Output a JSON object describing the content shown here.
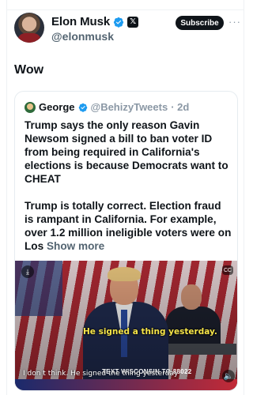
{
  "author": {
    "name": "Elon Musk",
    "handle": "@elonmusk",
    "x_badge": "𝕏"
  },
  "header": {
    "subscribe_label": "Subscribe",
    "more_label": "···"
  },
  "post": {
    "text": "Wow"
  },
  "quote": {
    "author_name": "George",
    "author_handle": "@BehizyTweets",
    "time": "· 2d",
    "paragraph1": "Trump says the only reason Gavin Newsom signed a bill to ban voter ID from being required in California's elections is because Democrats want to CHEAT",
    "paragraph2": "Trump is totally correct. Election fraud is rampant in California. For example, over 1.2 million ineligible voters were on Los",
    "show_more": "Show more"
  },
  "video": {
    "caption_overlay": "He signed a thing yesterday.",
    "subtitle": "I don t think. He signed the thing yesterday",
    "ticker": "TEXT WISCONSIN TO 88022",
    "download_icon": "download-icon",
    "cc_icon": "closed-caption-icon",
    "volume_icon": "volume-icon"
  },
  "colors": {
    "verified": "#1d9bf0",
    "text": "#0f1419",
    "muted": "#536471"
  }
}
